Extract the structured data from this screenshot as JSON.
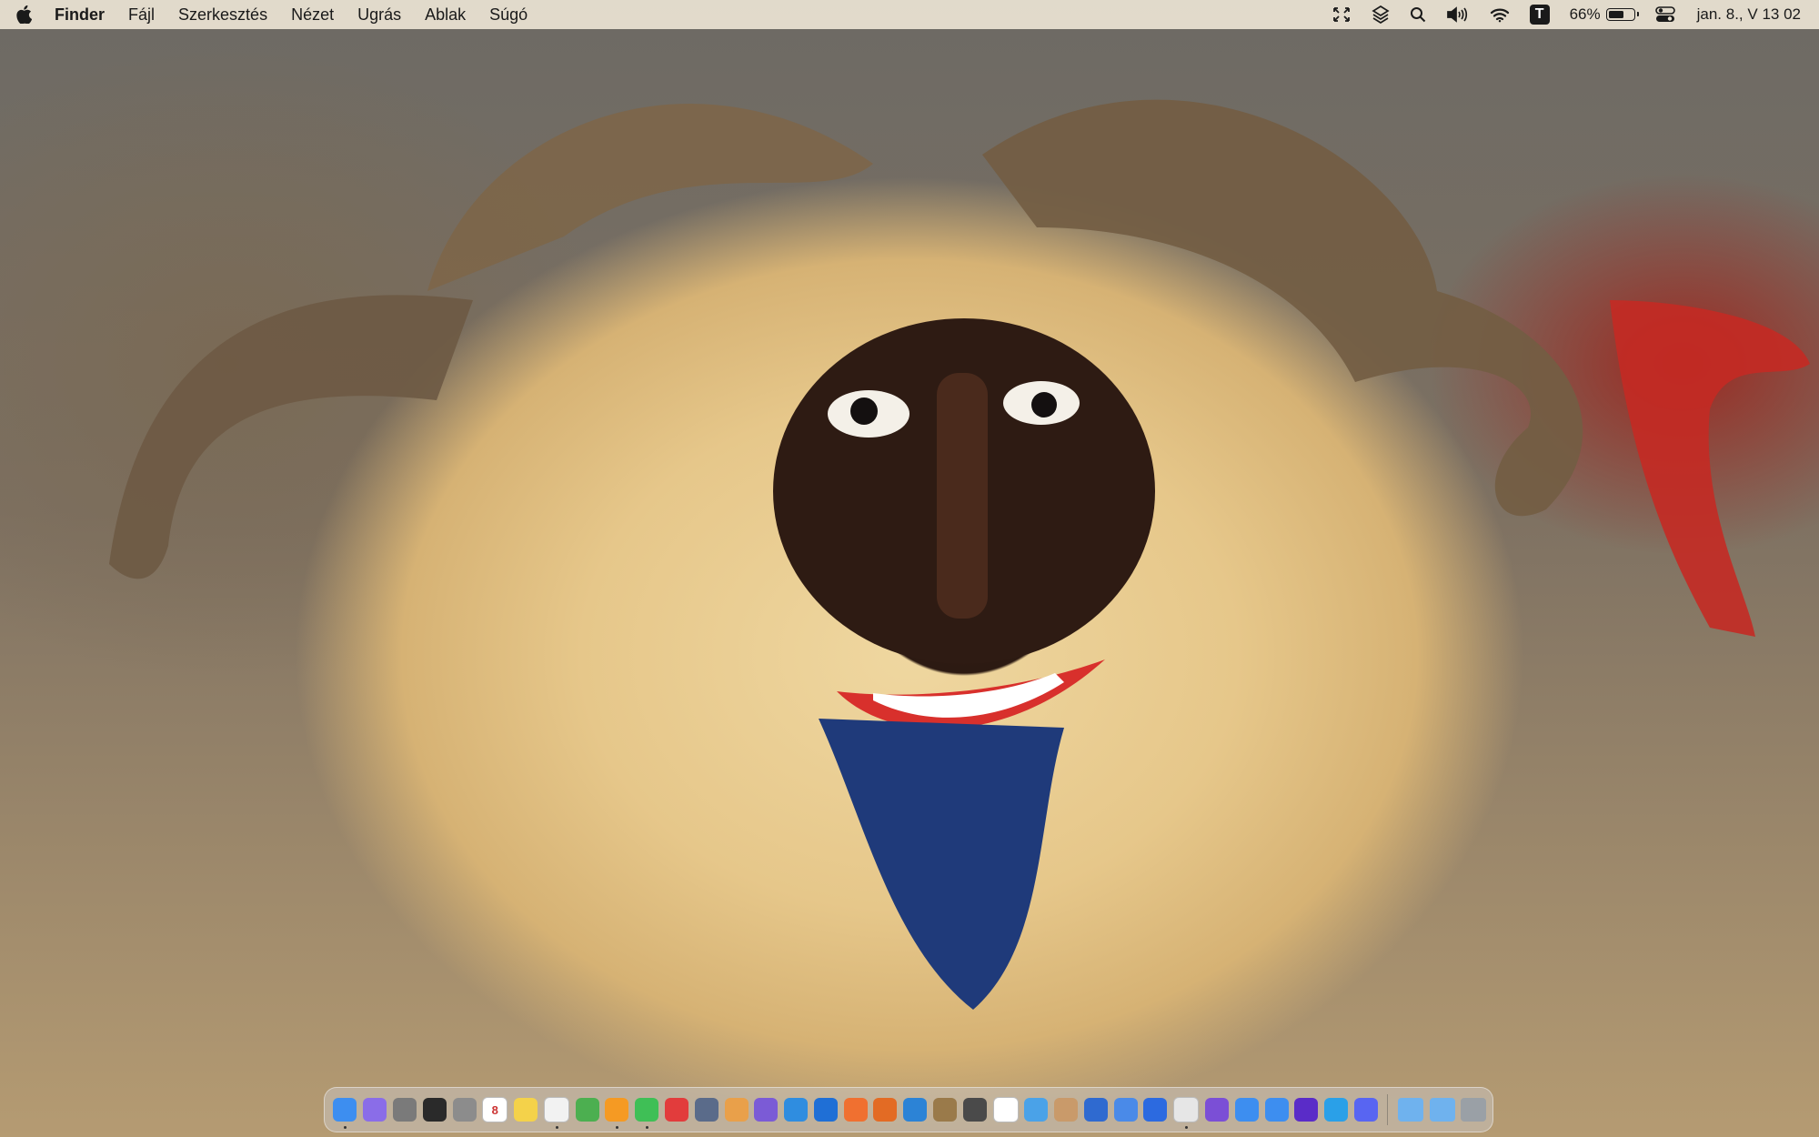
{
  "menubar": {
    "apple_icon": "apple-icon",
    "app_name": "Finder",
    "items": [
      "Fájl",
      "Szerkesztés",
      "Nézet",
      "Ugrás",
      "Ablak",
      "Súgó"
    ],
    "status_icons": [
      "screen-resize-icon",
      "layers-icon",
      "search-icon",
      "volume-icon",
      "wifi-icon",
      "t-app-icon"
    ],
    "t_icon_letter": "T",
    "battery_percent": "66%",
    "battery_level": 0.66,
    "control_center_icon": "control-center-icon",
    "clock": "jan. 8., V  13 02"
  },
  "dock": {
    "apps": [
      {
        "name": "finder",
        "color": "#3d8ef0",
        "running": true
      },
      {
        "name": "screen-app",
        "color": "#8a6de8",
        "running": false
      },
      {
        "name": "activity-app",
        "color": "#7a7a7a",
        "running": false
      },
      {
        "name": "terminal",
        "color": "#2a2a2a",
        "running": false
      },
      {
        "name": "system-settings",
        "color": "#8c8c8c",
        "running": false
      },
      {
        "name": "calendar",
        "color": "#ffffff",
        "running": false,
        "label": "8"
      },
      {
        "name": "notes",
        "color": "#f4d24a",
        "running": false
      },
      {
        "name": "textedit",
        "color": "#f2f2f2",
        "running": true
      },
      {
        "name": "chrome",
        "color": "#4caf50",
        "running": false
      },
      {
        "name": "pages",
        "color": "#f59a23",
        "running": true
      },
      {
        "name": "numbers",
        "color": "#3fbf56",
        "running": true
      },
      {
        "name": "keynote-red",
        "color": "#e23c3c",
        "running": false
      },
      {
        "name": "storage-app",
        "color": "#5a6b8a",
        "running": false
      },
      {
        "name": "photos",
        "color": "#e9a04a",
        "running": false
      },
      {
        "name": "affinity-designer",
        "color": "#7b5bd6",
        "running": false
      },
      {
        "name": "affinity-photo",
        "color": "#2f8de0",
        "running": false
      },
      {
        "name": "flow-app",
        "color": "#1f6fd6",
        "running": false
      },
      {
        "name": "firefox-app",
        "color": "#f07030",
        "running": false
      },
      {
        "name": "office-app",
        "color": "#e36b24",
        "running": false
      },
      {
        "name": "browser-app",
        "color": "#2c83d6",
        "running": false
      },
      {
        "name": "paint-app",
        "color": "#9a7a4a",
        "running": false
      },
      {
        "name": "calculator",
        "color": "#4a4a4a",
        "running": false
      },
      {
        "name": "clock",
        "color": "#ffffff",
        "running": false
      },
      {
        "name": "cloud-app",
        "color": "#4aa2e8",
        "running": false
      },
      {
        "name": "game-app",
        "color": "#c99a6a",
        "running": false
      },
      {
        "name": "bluedock-app",
        "color": "#2f6ad0",
        "running": false
      },
      {
        "name": "xcode-app",
        "color": "#4a8ae8",
        "running": false
      },
      {
        "name": "mail-m-app",
        "color": "#2c6ae0",
        "running": false
      },
      {
        "name": "vpn-app",
        "color": "#e6e6e6",
        "running": true
      },
      {
        "name": "plus-app",
        "color": "#7b4fd6",
        "running": false
      },
      {
        "name": "safari",
        "color": "#3d8ef0",
        "running": false
      },
      {
        "name": "mail",
        "color": "#3d8ef0",
        "running": false
      },
      {
        "name": "chart-app",
        "color": "#5a2cc8",
        "running": false
      },
      {
        "name": "skype",
        "color": "#2aa0e8",
        "running": false
      },
      {
        "name": "discord",
        "color": "#5865f2",
        "running": false
      }
    ],
    "folders": [
      {
        "name": "applications-folder",
        "color": "#6fb2ee"
      },
      {
        "name": "downloads-folder",
        "color": "#6fb2ee"
      },
      {
        "name": "trash",
        "color": "#9aa0a6"
      }
    ]
  }
}
